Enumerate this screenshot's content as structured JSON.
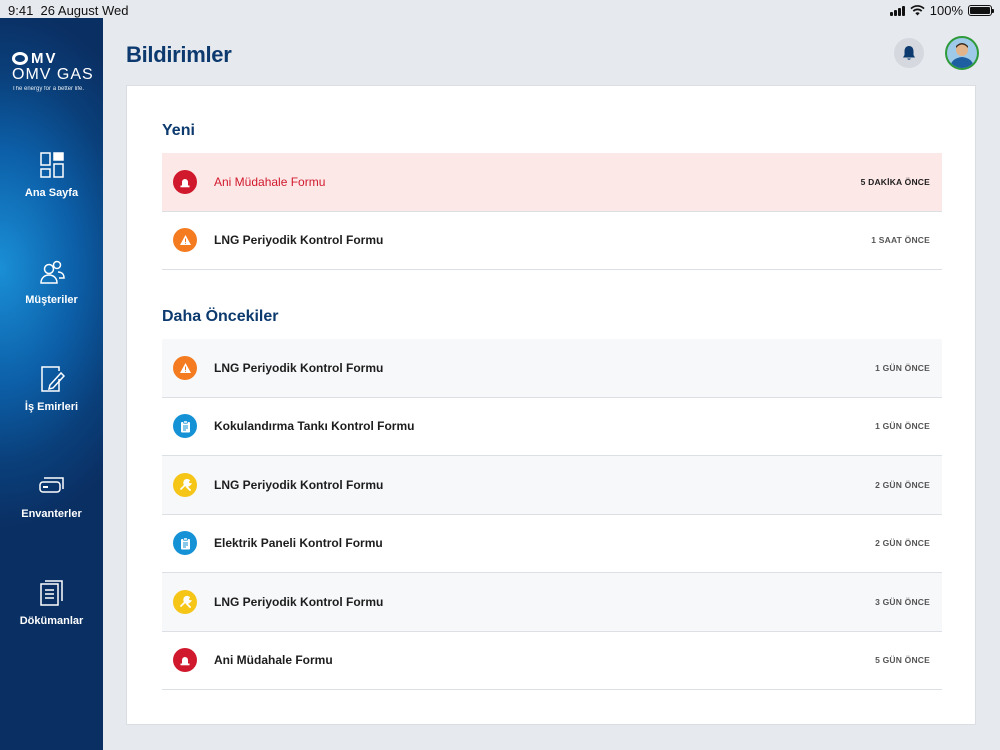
{
  "status_bar": {
    "time": "9:41",
    "date": "26 August Wed",
    "battery": "100%"
  },
  "logo": {
    "text": "OMV GAS",
    "tagline": "The energy for a better life."
  },
  "sidebar": {
    "items": [
      {
        "label": "Ana Sayfa",
        "icon": "dashboard-icon"
      },
      {
        "label": "Müşteriler",
        "icon": "users-icon"
      },
      {
        "label": "İş Emirleri",
        "icon": "edit-document-icon"
      },
      {
        "label": "Envanterler",
        "icon": "inventory-icon"
      },
      {
        "label": "Dökümanlar",
        "icon": "documents-icon"
      }
    ]
  },
  "header": {
    "title": "Bildirimler"
  },
  "colors": {
    "accent_red": "#d0192c",
    "accent_orange": "#f47b20",
    "accent_yellow": "#f5c518",
    "accent_blue": "#1592d6",
    "title_navy": "#0d3a6e"
  },
  "sections": {
    "new": {
      "title": "Yeni",
      "rows": [
        {
          "title": "Ani Müdahale Formu",
          "time": "5 DAKİKA ÖNCE",
          "icon": "alarm-icon"
        },
        {
          "title": "LNG Periyodik Kontrol Formu",
          "time": "1 SAAT ÖNCE",
          "icon": "warning-icon"
        }
      ]
    },
    "older": {
      "title": "Daha Öncekiler",
      "rows": [
        {
          "title": "LNG Periyodik Kontrol Formu",
          "time": "1 GÜN ÖNCE",
          "icon": "warning-icon"
        },
        {
          "title": "Kokulandırma Tankı Kontrol Formu",
          "time": "1 GÜN ÖNCE",
          "icon": "clipboard-icon"
        },
        {
          "title": "LNG Periyodik Kontrol Formu",
          "time": "2 GÜN ÖNCE",
          "icon": "wrench-icon"
        },
        {
          "title": "Elektrik Paneli Kontrol Formu",
          "time": "2 GÜN ÖNCE",
          "icon": "clipboard-icon"
        },
        {
          "title": "LNG Periyodik Kontrol Formu",
          "time": "3 GÜN ÖNCE",
          "icon": "wrench-icon"
        },
        {
          "title": "Ani Müdahale Formu",
          "time": "5 GÜN ÖNCE",
          "icon": "alarm-icon"
        }
      ]
    }
  }
}
